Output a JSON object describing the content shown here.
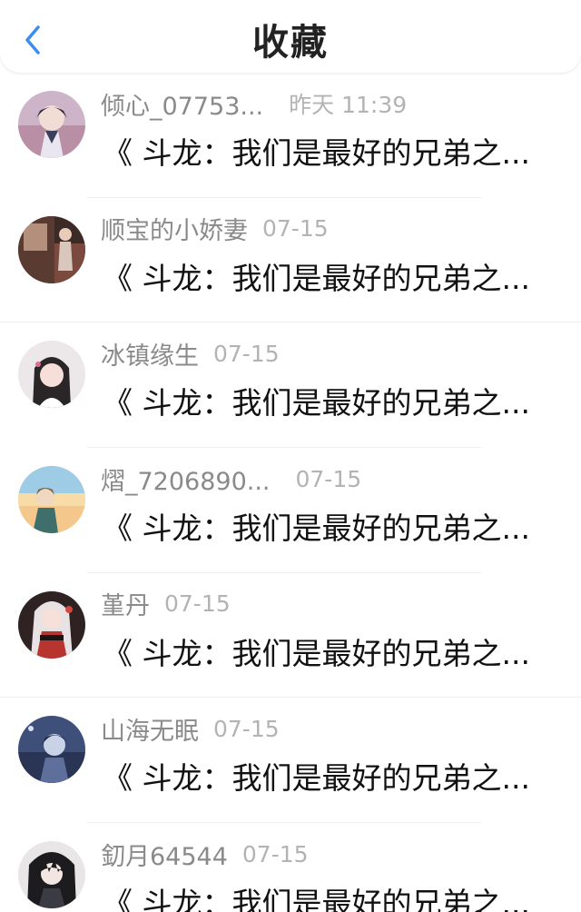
{
  "header": {
    "title": "收藏",
    "back_icon": "chevron-left-icon",
    "accent_color": "#3a8ef0"
  },
  "items": [
    {
      "name": "倾心_07753...",
      "time": "昨天 11:39",
      "snippet": "《 斗龙：我们是最好的兄弟之...",
      "avatar": "avatar-anime-boy-pink"
    },
    {
      "name": "顺宝的小娇妻",
      "time": "07-15",
      "snippet": "《 斗龙：我们是最好的兄弟之...",
      "avatar": "avatar-dark-room"
    },
    {
      "name": "冰镇缘生",
      "time": "07-15",
      "snippet": "《 斗龙：我们是最好的兄弟之...",
      "avatar": "avatar-girl-photo"
    },
    {
      "name": "熠_7206890...",
      "time": "07-15",
      "snippet": "《 斗龙：我们是最好的兄弟之...",
      "avatar": "avatar-anime-sunset"
    },
    {
      "name": "堇丹",
      "time": "07-15",
      "snippet": "《 斗龙：我们是最好的兄弟之...",
      "avatar": "avatar-anime-red-girl"
    },
    {
      "name": "山海无眠",
      "time": "07-15",
      "snippet": "《 斗龙：我们是最好的兄弟之...",
      "avatar": "avatar-anime-blue"
    },
    {
      "name": "釖月64544",
      "time": "07-15",
      "snippet": "《 斗龙：我们是最好的兄弟之...",
      "avatar": "avatar-anime-dark-hair"
    }
  ]
}
